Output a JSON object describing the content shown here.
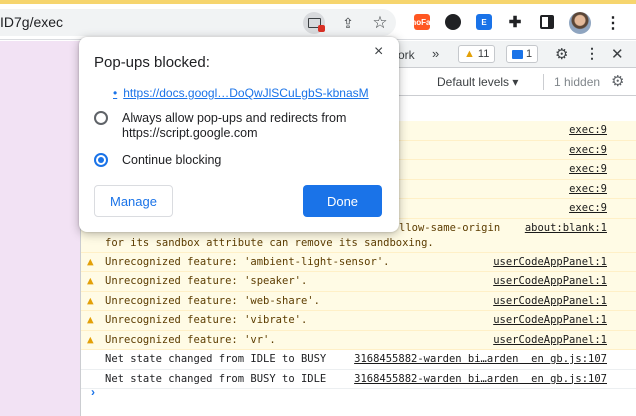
{
  "browser": {
    "url": "ID7g/exec",
    "extensions": {
      "orange_label": "noFai"
    }
  },
  "devtools": {
    "tab_partial": "ork",
    "more_label": "»",
    "warn_count": "11",
    "msg_count": "1",
    "levels_label": "Default levels ▾",
    "hidden_label": "1 hidden",
    "rows": [
      {
        "text": ".",
        "source": "exec:9"
      },
      {
        "text": "",
        "source": "exec:9"
      },
      {
        "text": "",
        "source": "exec:9"
      },
      {
        "text": "",
        "source": "exec:9"
      },
      {
        "text": ".",
        "source": "exec:9"
      },
      {
        "text": "llow-same-origin",
        "text2": "for its sandbox attribute can remove its sandboxing.",
        "source": "about:blank:1"
      },
      {
        "text": "Unrecognized feature: 'ambient-light-sensor'.",
        "source": "userCodeAppPanel:1"
      },
      {
        "text": "Unrecognized feature: 'speaker'.",
        "source": "userCodeAppPanel:1"
      },
      {
        "text": "Unrecognized feature: 'web-share'.",
        "source": "userCodeAppPanel:1"
      },
      {
        "text": "Unrecognized feature: 'vibrate'.",
        "source": "userCodeAppPanel:1"
      },
      {
        "text": "Unrecognized feature: 'vr'.",
        "source": "userCodeAppPanel:1"
      },
      {
        "text": "Net state changed from IDLE to BUSY",
        "source": "3168455882-warden bi…arden  en gb.js:107"
      },
      {
        "text": "Net state changed from BUSY to IDLE",
        "source": "3168455882-warden bi…arden  en gb.js:107"
      }
    ],
    "prompt": "›"
  },
  "popup": {
    "title": "Pop-ups blocked:",
    "close": "×",
    "link": "https://docs.googl…DoQwJlSCuLgbS-kbnasM",
    "option_allow": "Always allow pop-ups and redirects from https://script.google.com",
    "option_block": "Continue blocking",
    "manage_label": "Manage",
    "done_label": "Done"
  }
}
